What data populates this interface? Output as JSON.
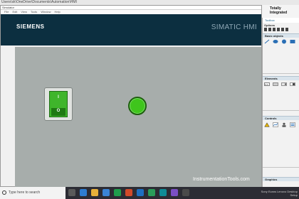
{
  "background_window": {
    "path": "Users\\sk\\OneDrive\\Documents\\Automation\\HMI",
    "tia_title": "Totally Integrated"
  },
  "simulator": {
    "title": "Simulator",
    "menu": [
      "File",
      "Edit",
      "View",
      "Tools",
      "Window",
      "Help"
    ],
    "header": {
      "brand": "SIEMENS",
      "product": "SIMATIC HMI"
    },
    "switch": {
      "on_label": "I",
      "off_label": "O",
      "state": "on"
    },
    "lamp": {
      "state": "on",
      "color": "#3fc51c"
    },
    "watermark": "InstrumentationTools.com"
  },
  "toolbox": {
    "title": "Toolbox",
    "options_label": "Options",
    "sections": [
      {
        "label": "Basic objects"
      },
      {
        "label": "Elements"
      },
      {
        "label": "Controls"
      },
      {
        "label": "Graphics"
      }
    ]
  },
  "taskbar": {
    "search_placeholder": "Type here to search",
    "tray_text": "Sony Evans Lenovo Desktop",
    "tray_text_2": "Setup"
  },
  "colors": {
    "hmi_header": "#0c2f40",
    "hmi_body": "#a7adab",
    "switch_green": "#3fb52b",
    "lamp_green": "#3fc51c"
  }
}
